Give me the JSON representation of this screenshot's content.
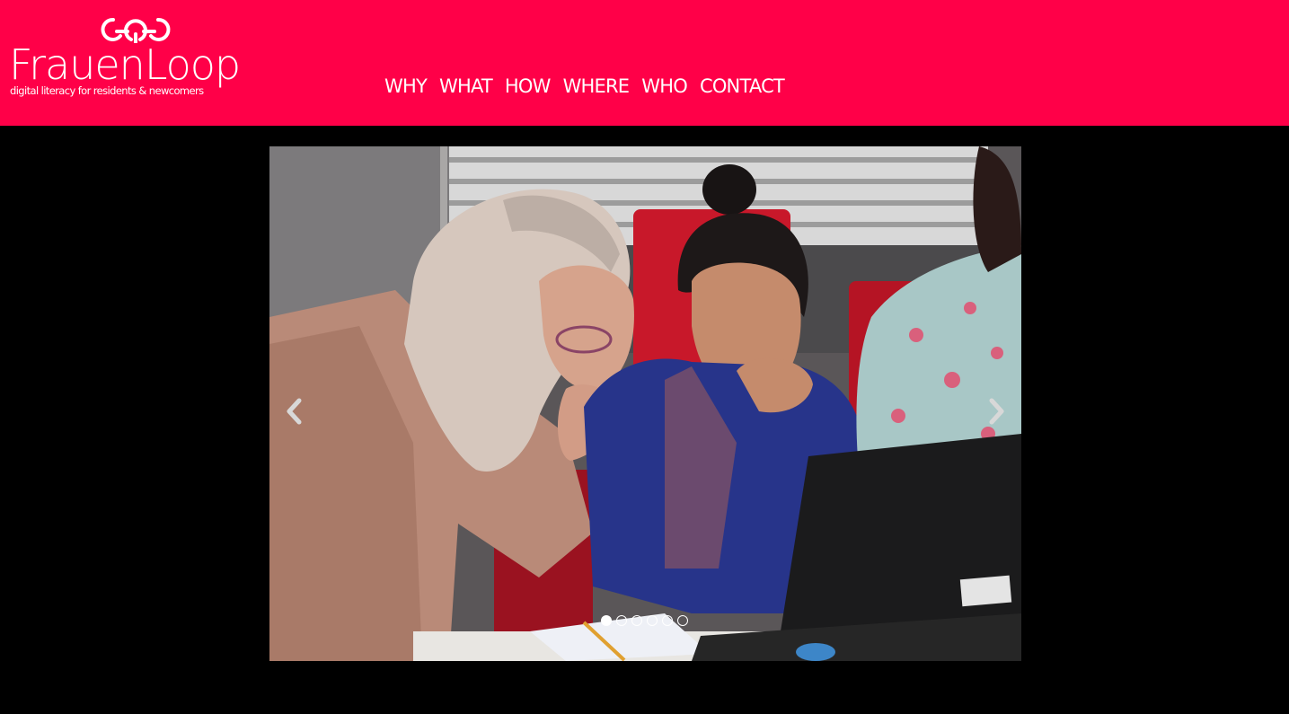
{
  "brand": {
    "name_part1": "Frauen",
    "name_part2": "Loop",
    "tagline": "digital literacy for residents & newcomers",
    "color": "#ff0048"
  },
  "nav": {
    "items": [
      {
        "label": "WHY"
      },
      {
        "label": "WHAT"
      },
      {
        "label": "HOW"
      },
      {
        "label": "WHERE"
      },
      {
        "label": "WHO"
      },
      {
        "label": "CONTACT"
      }
    ]
  },
  "carousel": {
    "slide_count": 6,
    "active_index": 0,
    "prev_icon": "chevron-left-icon",
    "next_icon": "chevron-right-icon"
  }
}
